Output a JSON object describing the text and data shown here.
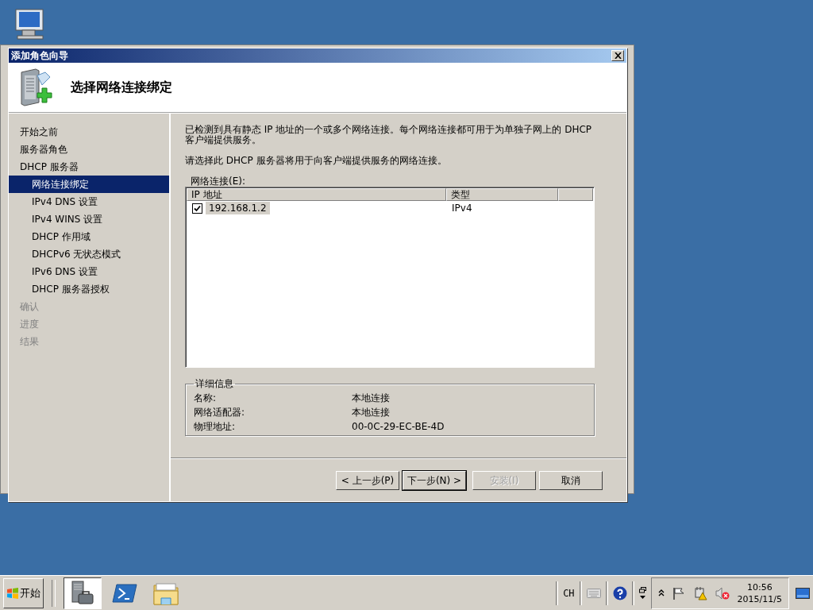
{
  "window": {
    "title": "添加角色向导"
  },
  "header": {
    "title": "选择网络连接绑定"
  },
  "nav": [
    {
      "label": "开始之前",
      "kind": "main",
      "selected": false,
      "disabled": false
    },
    {
      "label": "服务器角色",
      "kind": "main",
      "selected": false,
      "disabled": false
    },
    {
      "label": "DHCP 服务器",
      "kind": "main",
      "selected": false,
      "disabled": false
    },
    {
      "label": "网络连接绑定",
      "kind": "sub",
      "selected": true,
      "disabled": false
    },
    {
      "label": "IPv4 DNS 设置",
      "kind": "sub",
      "selected": false,
      "disabled": false
    },
    {
      "label": "IPv4 WINS 设置",
      "kind": "sub",
      "selected": false,
      "disabled": false
    },
    {
      "label": "DHCP 作用域",
      "kind": "sub",
      "selected": false,
      "disabled": false
    },
    {
      "label": "DHCPv6 无状态模式",
      "kind": "sub",
      "selected": false,
      "disabled": false
    },
    {
      "label": "IPv6 DNS 设置",
      "kind": "sub",
      "selected": false,
      "disabled": false
    },
    {
      "label": "DHCP 服务器授权",
      "kind": "sub",
      "selected": false,
      "disabled": false
    },
    {
      "label": "确认",
      "kind": "main",
      "selected": false,
      "disabled": true
    },
    {
      "label": "进度",
      "kind": "main",
      "selected": false,
      "disabled": true
    },
    {
      "label": "结果",
      "kind": "main",
      "selected": false,
      "disabled": true
    }
  ],
  "intro": [
    "已检测到具有静态 IP 地址的一个或多个网络连接。每个网络连接都可用于为单独子网上的 DHCP 客户端提供服务。",
    "请选择此 DHCP 服务器将用于向客户端提供服务的网络连接。"
  ],
  "connections": {
    "label": "网络连接(E):",
    "columns": [
      "IP 地址",
      "类型"
    ],
    "rows": [
      {
        "ip": "192.168.1.2",
        "type": "IPv4",
        "checked": true,
        "selected": true
      }
    ]
  },
  "details": {
    "title": "详细信息",
    "fields": [
      {
        "label": "名称:",
        "value": "本地连接"
      },
      {
        "label": "网络适配器:",
        "value": "本地连接"
      },
      {
        "label": "物理地址:",
        "value": "00-0C-29-EC-BE-4D"
      }
    ]
  },
  "buttons": [
    {
      "label": "< 上一步(P)",
      "kind": "normal",
      "disabled": false
    },
    {
      "label": "下一步(N) >",
      "kind": "default",
      "disabled": false
    },
    {
      "label": "安装(I)",
      "kind": "normal",
      "disabled": true
    },
    {
      "label": "取消",
      "kind": "normal",
      "disabled": false
    }
  ],
  "taskbar": {
    "start": "开始",
    "language": "CH",
    "time": "10:56",
    "date": "2015/11/5"
  }
}
